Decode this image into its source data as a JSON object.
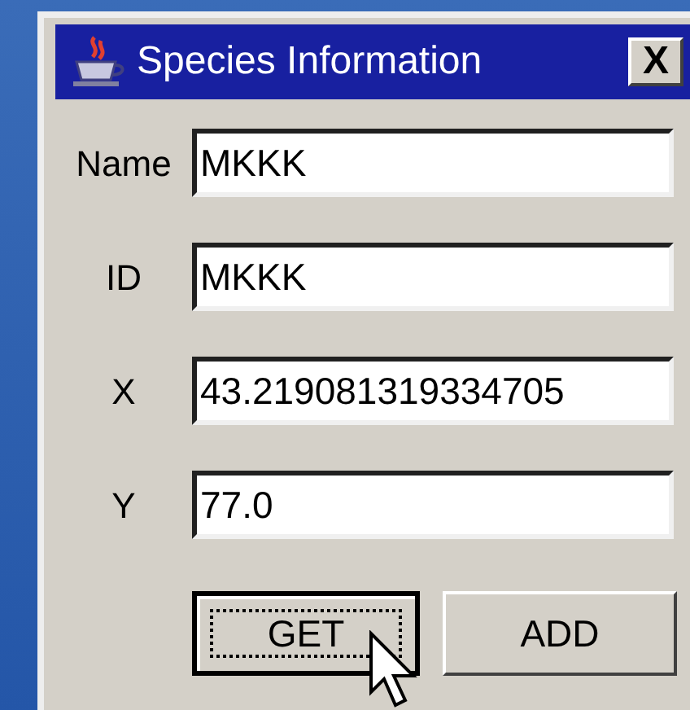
{
  "window": {
    "title": "Species Information",
    "close": "X"
  },
  "fields": [
    {
      "label": "Name",
      "value": "MKKK"
    },
    {
      "label": "ID",
      "value": "MKKK"
    },
    {
      "label": "X",
      "value": "43.219081319334705"
    },
    {
      "label": "Y",
      "value": "77.0"
    }
  ],
  "buttons": [
    {
      "label": "GET",
      "focused": true
    },
    {
      "label": "ADD",
      "focused": false
    }
  ]
}
